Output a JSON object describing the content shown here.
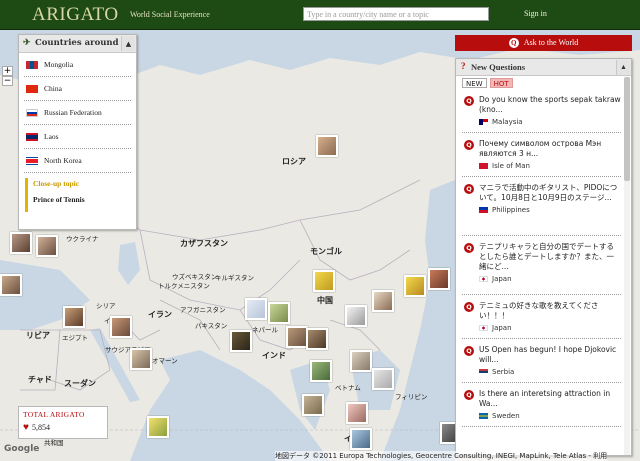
{
  "header": {
    "logo": "ARIGATO",
    "tagline": "World Social Experience",
    "search_placeholder": "Type in a country/city name or a topic",
    "signin": "Sign in"
  },
  "map": {
    "labels": [
      "ロシア",
      "カザフスタン",
      "モンゴル",
      "中国",
      "ウクライナ",
      "ウズベキスタン",
      "トルクメニスタン",
      "キルギスタン",
      "アフガニスタン",
      "パキスタン",
      "イラン",
      "ネパール",
      "インド",
      "シリア",
      "イラク",
      "エジプト",
      "リビア",
      "チャド",
      "スーダン",
      "サウジアラビア",
      "オマーン",
      "ベトナム",
      "フィリピン",
      "共和国",
      "イ"
    ],
    "google": "Google",
    "copyright": "地図データ ©2011 Europa Technologies, Geocentre Consulting, INEGI, MapLink, Tele Atlas - 利用"
  },
  "countries_panel": {
    "title": "Countries around",
    "items": [
      {
        "name": "Mongolia",
        "flag": "mongolia"
      },
      {
        "name": "China",
        "flag": "china"
      },
      {
        "name": "Russian Federation",
        "flag": "russia"
      },
      {
        "name": "Laos",
        "flag": "laos"
      },
      {
        "name": "North Korea",
        "flag": "north-korea"
      }
    ],
    "closeup_label": "Close-up topic",
    "closeup_topic": "Prince of Tennis"
  },
  "ask_button": "Ask to the World",
  "questions_panel": {
    "title": "New Questions",
    "tab_new": "NEW",
    "tab_hot": "HOT",
    "items": [
      {
        "text": "Do you know the sports sepak takraw (kno...",
        "country": "Malaysia",
        "flag": "malaysia"
      },
      {
        "text": "Почему символом острова Мэн являются 3 н...",
        "country": "Isle of Man",
        "flag": "isle-of-man"
      },
      {
        "text": "マニラで活動中のギタリスト、PIDOについて。10月8日と10月9日のステージ...",
        "country": "Philippines",
        "flag": "philippines"
      },
      {
        "text": "テニプリキャラと自分の国でデートするとしたら誰とデートしますか？また、一緒にど...",
        "country": "Japan",
        "flag": "japan"
      },
      {
        "text": "テニミュの好きな歌を教えてください！！！",
        "country": "Japan",
        "flag": "japan"
      },
      {
        "text": "US Open has begun! I hope Djokovic will...",
        "country": "Serbia",
        "flag": "serbia"
      },
      {
        "text": "Is there an interetsing attraction in Wa...",
        "country": "Sweden",
        "flag": "sweden"
      }
    ]
  },
  "total": {
    "label": "TOTAL ARIGATO",
    "value": "5,854"
  },
  "colors": {
    "header_bg": "#1e4a14",
    "accent_red": "#b80d0d",
    "closeup_gold": "#c89a00"
  }
}
